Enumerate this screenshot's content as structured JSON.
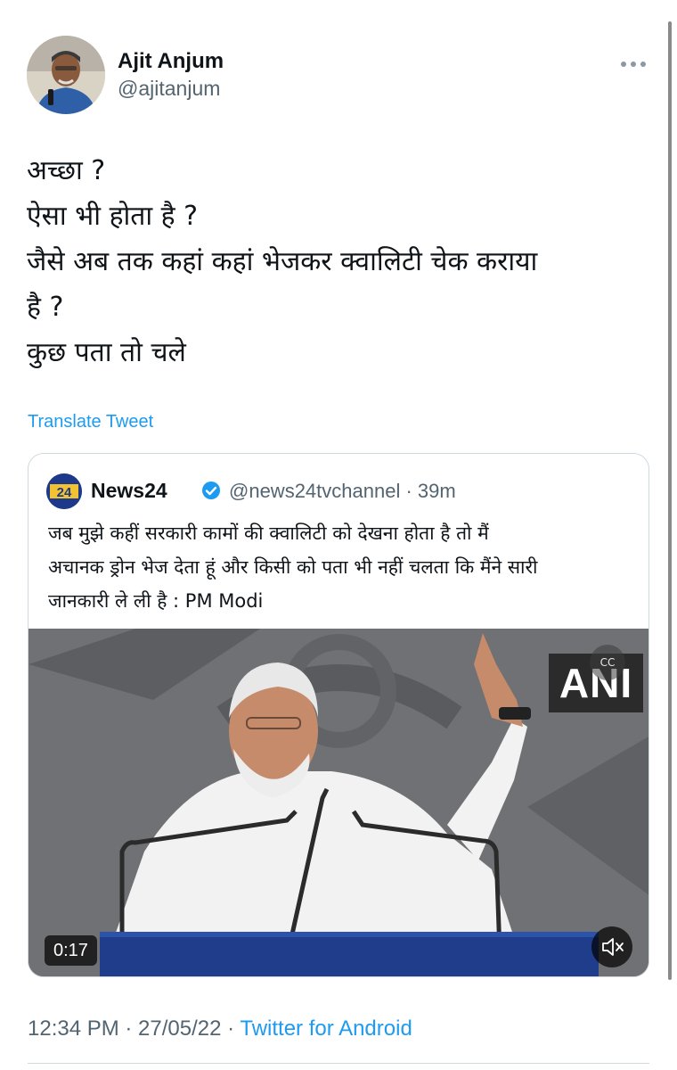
{
  "author": {
    "display_name": "Ajit Anjum",
    "handle": "@ajitanjum"
  },
  "more_icon": "more-horizontal-icon",
  "tweet": {
    "lines": [
      "अच्छा ?",
      "ऐसा भी होता है ?",
      "जैसे अब तक कहां कहां भेजकर क्वालिटी चेक कराया",
      "है ?",
      "कुछ पता तो चले"
    ],
    "translate_label": "Translate Tweet"
  },
  "quoted": {
    "logo_text": "24",
    "name": "News24",
    "verified_icon": "verified-badge-icon",
    "handle": "@news24tvchannel",
    "time": "· 39m",
    "lines": [
      "जब मुझे कहीं सरकारी कामों की क्वालिटी को देखना होता है तो मैं",
      "अचानक ड्रोन भेज देता हूं और किसी को पता भी नहीं चलता कि मैंने सारी",
      "जानकारी ले ली है : PM Modi"
    ],
    "video": {
      "watermark": "ANI",
      "cc_label": "CC",
      "duration": "0:17"
    }
  },
  "footer": {
    "timestamp": "12:34 PM · 27/05/22 ·",
    "source": "Twitter for Android"
  },
  "colors": {
    "accent": "#1d9bf0",
    "secondary_text": "#536471",
    "border": "#cfd9de"
  }
}
